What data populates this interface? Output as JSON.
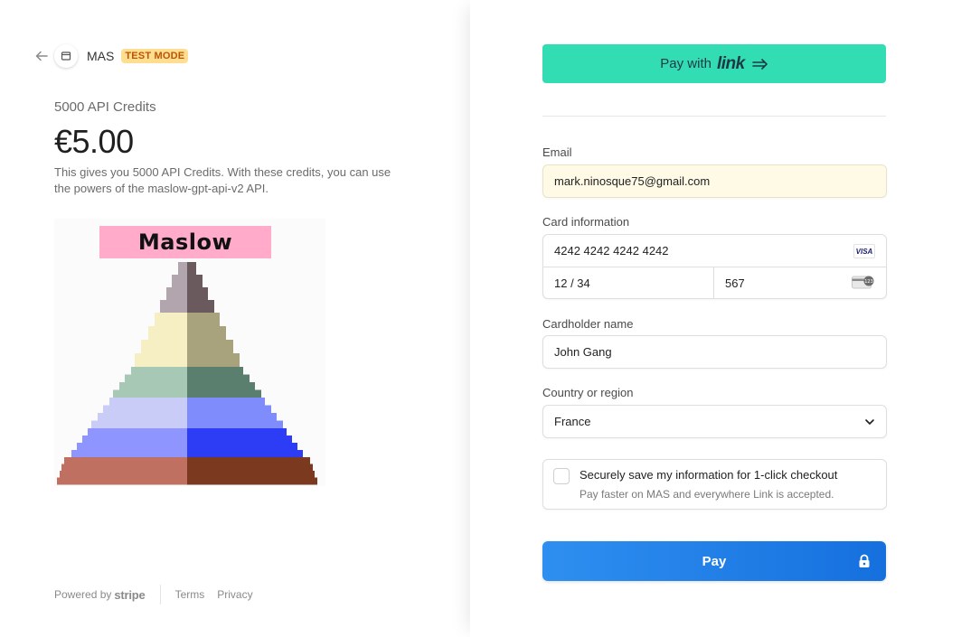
{
  "merchant": {
    "name": "MAS",
    "badge": "TEST MODE"
  },
  "product": {
    "name": "5000 API Credits",
    "price": "€5.00",
    "description": "This gives you 5000 API Credits. With these credits, you can use the powers of the maslow-gpt-api-v2 API.",
    "image_label": "Maslow"
  },
  "footer": {
    "powered_by": "Powered by",
    "brand": "stripe",
    "terms": "Terms",
    "privacy": "Privacy"
  },
  "link_button": {
    "prefix": "Pay with",
    "brand": "link"
  },
  "form": {
    "email": {
      "label": "Email",
      "value": "mark.ninosque75@gmail.com"
    },
    "card": {
      "label": "Card information",
      "number": "4242 4242 4242 4242",
      "expiry": "12 / 34",
      "cvc": "567",
      "brand_text": "VISA"
    },
    "cardholder": {
      "label": "Cardholder name",
      "value": "John Gang"
    },
    "country": {
      "label": "Country or region",
      "value": "France"
    },
    "save_info": {
      "title": "Securely save my information for 1-click checkout",
      "subtitle": "Pay faster on MAS and everywhere Link is accepted.",
      "checked": false
    }
  },
  "pay_button": {
    "label": "Pay"
  },
  "colors": {
    "link_green": "#33ddb3",
    "pay_blue_start": "#2f8ff0",
    "pay_blue_end": "#1570de",
    "test_badge_bg": "#ffde92",
    "test_badge_text": "#bb5504",
    "autofill_bg": "#fefae6",
    "maslow_label_bg": "#ffabc9"
  },
  "pyramid_colors": {
    "left": [
      "#b3a5ae",
      "#f7efc4",
      "#a7c8b5",
      "#c9ccf7",
      "#8f95ff",
      "#c07061"
    ],
    "right": [
      "#6a5a5e",
      "#a9a37d",
      "#5a7f6e",
      "#7f8cfb",
      "#2d3cf5",
      "#7b3a1f"
    ]
  }
}
